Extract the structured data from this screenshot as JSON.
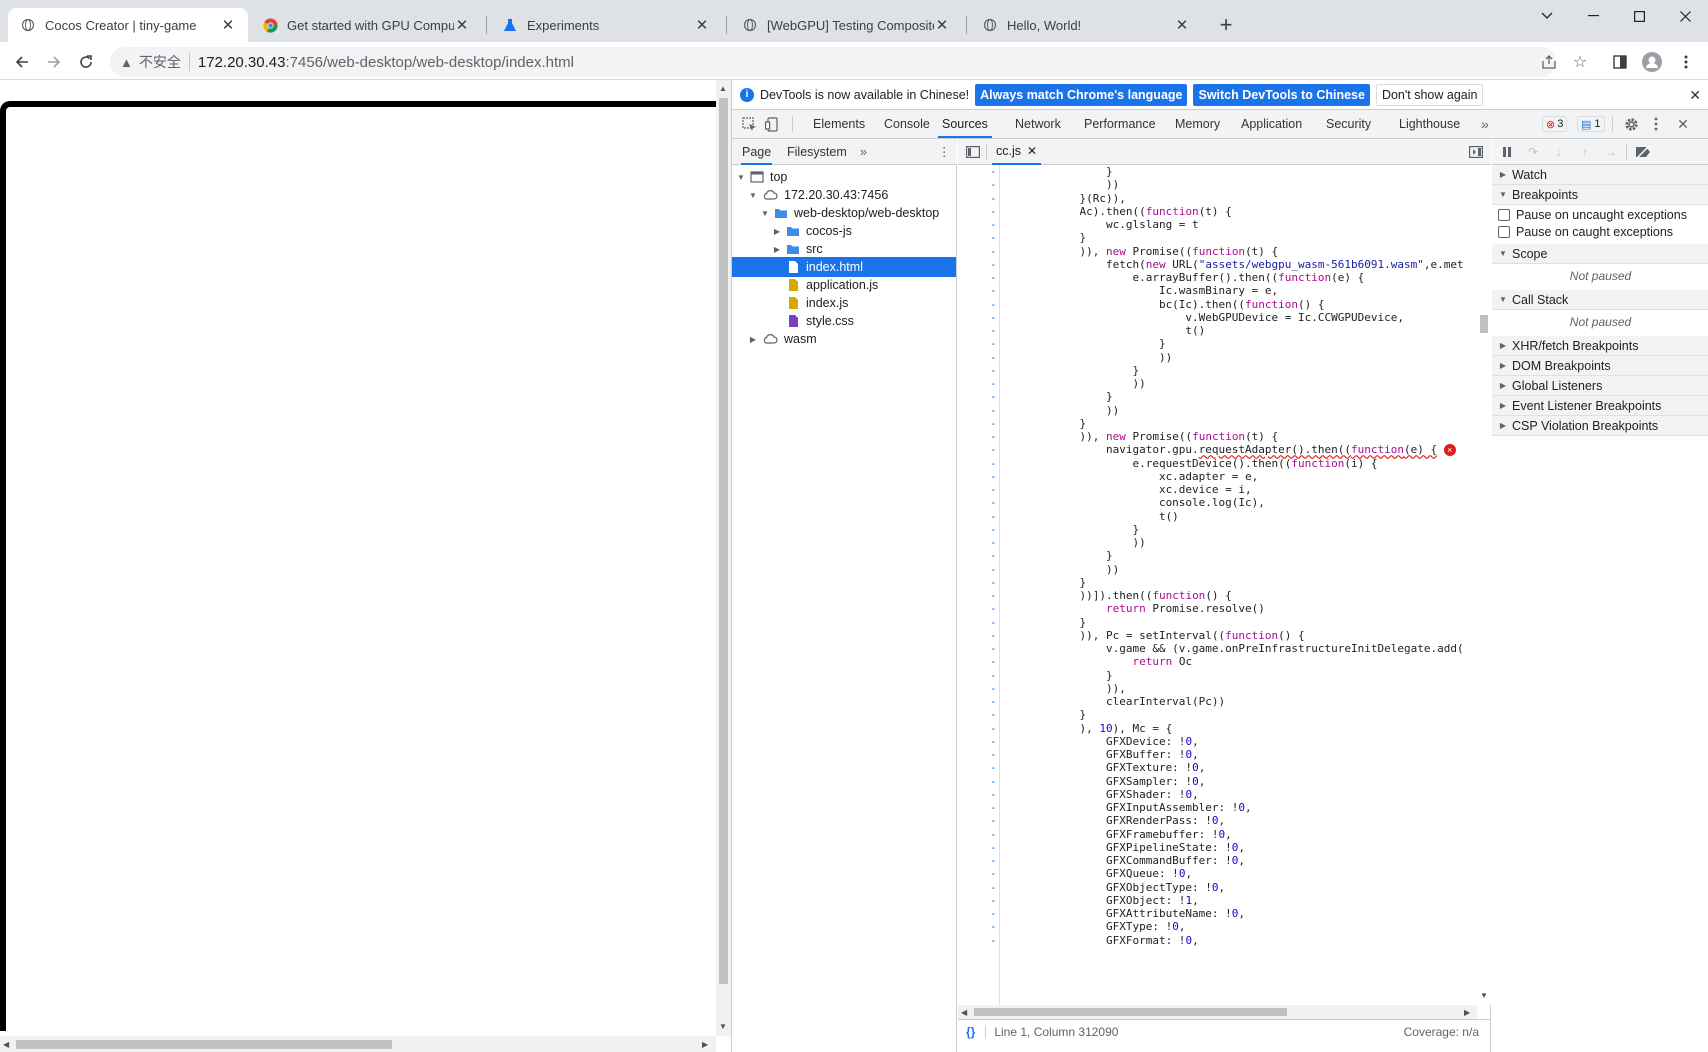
{
  "browser": {
    "tabs": [
      {
        "title": "Cocos Creator | tiny-game",
        "icon": "globe-icon",
        "active": true
      },
      {
        "title": "Get started with GPU Comput",
        "icon": "chrome-icon",
        "active": false
      },
      {
        "title": "Experiments",
        "icon": "flask-icon",
        "active": false
      },
      {
        "title": "[WebGPU] Testing Composite",
        "icon": "globe-icon",
        "active": false
      },
      {
        "title": "Hello, World!",
        "icon": "globe-icon",
        "active": false
      }
    ],
    "security_label": "不安全",
    "url_host": "172.20.30.43",
    "url_path": ":7456/web-desktop/web-desktop/index.html"
  },
  "devtools": {
    "infobar": {
      "message": "DevTools is now available in Chinese!",
      "btn_match": "Always match Chrome's language",
      "btn_switch": "Switch DevTools to Chinese",
      "btn_dismiss": "Don't show again"
    },
    "tabs": [
      "Elements",
      "Console",
      "Sources",
      "Network",
      "Performance",
      "Memory",
      "Application",
      "Security",
      "Lighthouse"
    ],
    "active_tab": "Sources",
    "error_count": "3",
    "message_count": "1",
    "navigator": {
      "tabs": [
        "Page",
        "Filesystem"
      ],
      "tree": [
        {
          "label": "top",
          "depth": 0,
          "icon": "frame-icon",
          "expanded": true
        },
        {
          "label": "172.20.30.43:7456",
          "depth": 1,
          "icon": "cloud-icon",
          "expanded": true
        },
        {
          "label": "web-desktop/web-desktop",
          "depth": 2,
          "icon": "folder-icon",
          "expanded": true
        },
        {
          "label": "cocos-js",
          "depth": 3,
          "icon": "folder-icon",
          "expanded": false
        },
        {
          "label": "src",
          "depth": 3,
          "icon": "folder-icon",
          "expanded": false
        },
        {
          "label": "index.html",
          "depth": 3,
          "icon": "file-icon",
          "selected": true
        },
        {
          "label": "application.js",
          "depth": 3,
          "icon": "js-file-icon"
        },
        {
          "label": "index.js",
          "depth": 3,
          "icon": "js-file-icon"
        },
        {
          "label": "style.css",
          "depth": 3,
          "icon": "css-file-icon"
        },
        {
          "label": "wasm",
          "depth": 1,
          "icon": "cloud-icon",
          "expanded": false
        }
      ]
    },
    "editor": {
      "file_tab": "cc.js",
      "lines": [
        "                }",
        "                ))",
        "            }(Rc)),",
        "            Ac).then((function(t) {",
        "                wc.glslang = t",
        "            }",
        "            )), new Promise((function(t) {",
        "                fetch(new URL(\"assets/webgpu_wasm-561b6091.wasm\",e.met",
        "                    e.arrayBuffer().then((function(e) {",
        "                        Ic.wasmBinary = e,",
        "                        bc(Ic).then((function() {",
        "                            v.WebGPUDevice = Ic.CCWGPUDevice,",
        "                            t()",
        "                        }",
        "                        ))",
        "                    }",
        "                    ))",
        "                }",
        "                ))",
        "            }",
        "            )), new Promise((function(t) {",
        "                navigator.gpu.requestAdapter().then((function(e) {",
        "                    e.requestDevice().then((function(i) {",
        "                        xc.adapter = e,",
        "                        xc.device = i,",
        "                        console.log(Ic),",
        "                        t()",
        "                    }",
        "                    ))",
        "                }",
        "                ))",
        "            }",
        "            ))]).then((function() {",
        "                return Promise.resolve()",
        "            }",
        "            )), Pc = setInterval((function() {",
        "                v.game && (v.game.onPreInfrastructureInitDelegate.add(",
        "                    return Oc",
        "                }",
        "                )),",
        "                clearInterval(Pc))",
        "            }",
        "            ), 10), Mc = {",
        "                GFXDevice: !0,",
        "                GFXBuffer: !0,",
        "                GFXTexture: !0,",
        "                GFXSampler: !0,",
        "                GFXShader: !0,",
        "                GFXInputAssembler: !0,",
        "                GFXRenderPass: !0,",
        "                GFXFramebuffer: !0,",
        "                GFXPipelineState: !0,",
        "                GFXCommandBuffer: !0,",
        "                GFXQueue: !0,",
        "                GFXObjectType: !0,",
        "                GFXObject: !1,",
        "                GFXAttributeName: !0,",
        "                GFXType: !0,",
        "                GFXFormat: !0,"
      ],
      "error_line_index": 21,
      "gutter_marker": "-",
      "error_icon_glyph": "×",
      "status_position": "Line 1, Column 312090",
      "status_coverage": "Coverage: n/a",
      "format_glyph": "{}"
    },
    "debugger": {
      "sections": {
        "watch": "Watch",
        "breakpoints": "Breakpoints",
        "pause_uncaught": "Pause on uncaught exceptions",
        "pause_caught": "Pause on caught exceptions",
        "scope": "Scope",
        "scope_status": "Not paused",
        "callstack": "Call Stack",
        "callstack_status": "Not paused",
        "xhr": "XHR/fetch Breakpoints",
        "dom": "DOM Breakpoints",
        "global": "Global Listeners",
        "event": "Event Listener Breakpoints",
        "csp": "CSP Violation Breakpoints"
      }
    }
  },
  "colors": {
    "accent": "#1a73e8",
    "error": "#e41a1a",
    "keyword": "#aa0d91",
    "string": "#1a1aa6",
    "folder": "#3a8ee6",
    "js_file": "#d7a800",
    "css_file": "#7b3fc1"
  }
}
